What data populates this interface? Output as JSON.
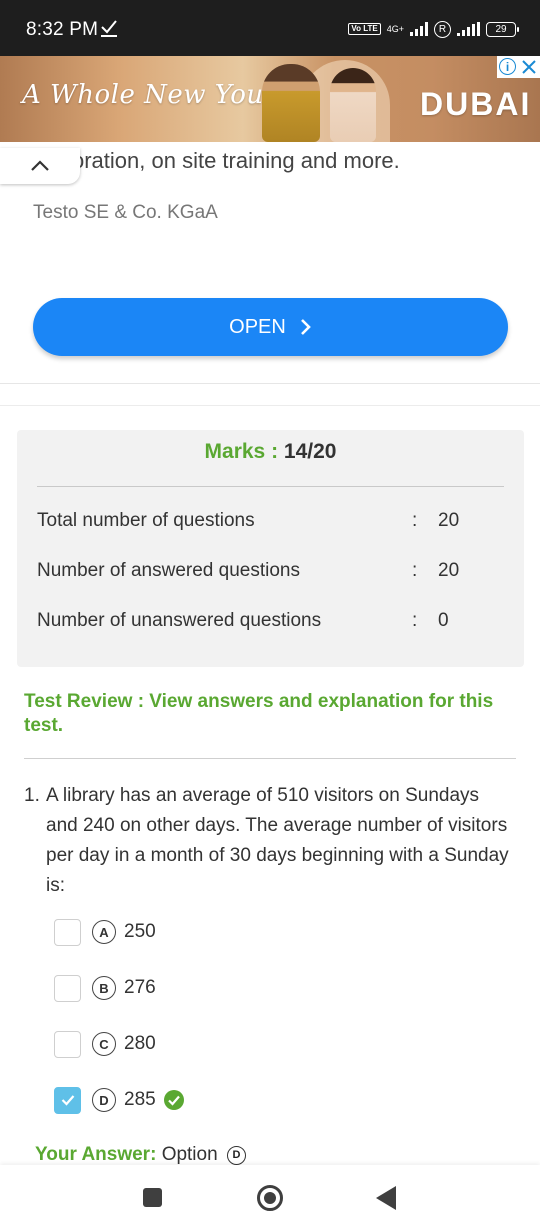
{
  "status_bar": {
    "time": "8:32 PM",
    "network_type": "4G+",
    "volte": "Vo LTE",
    "battery": "29"
  },
  "ad_banner": {
    "tagline": "A Whole New You",
    "brand": "DUBAI"
  },
  "ad_card": {
    "description": "oration, on site training and more.",
    "advertiser": "Testo SE & Co. KGaA",
    "open_label": "OPEN"
  },
  "result": {
    "marks_label": "Marks :",
    "marks_value": "14/20",
    "stats": [
      {
        "label": "Total number of questions",
        "value": "20"
      },
      {
        "label": "Number of answered questions",
        "value": "20"
      },
      {
        "label": "Number of unanswered questions",
        "value": "0"
      }
    ],
    "review_link": "Test Review : View answers and explanation for this test."
  },
  "question": {
    "number": "1.",
    "text": "A library has an average of 510 visitors on Sundays and 240 on other days. The average number of visitors per day in a month of 30 days beginning with a Sunday is:",
    "options": [
      {
        "letter": "A",
        "value": "250",
        "checked": false,
        "correct": false
      },
      {
        "letter": "B",
        "value": "276",
        "checked": false,
        "correct": false
      },
      {
        "letter": "C",
        "value": "280",
        "checked": false,
        "correct": false
      },
      {
        "letter": "D",
        "value": "285",
        "checked": true,
        "correct": true
      }
    ],
    "your_answer_label": "Your Answer:",
    "your_answer_text": "Option",
    "your_answer_letter": "D"
  },
  "colors": {
    "accent_green": "#5aa832",
    "open_button_blue": "#1b86f6",
    "checkbox_checked": "#5fc0e8"
  }
}
